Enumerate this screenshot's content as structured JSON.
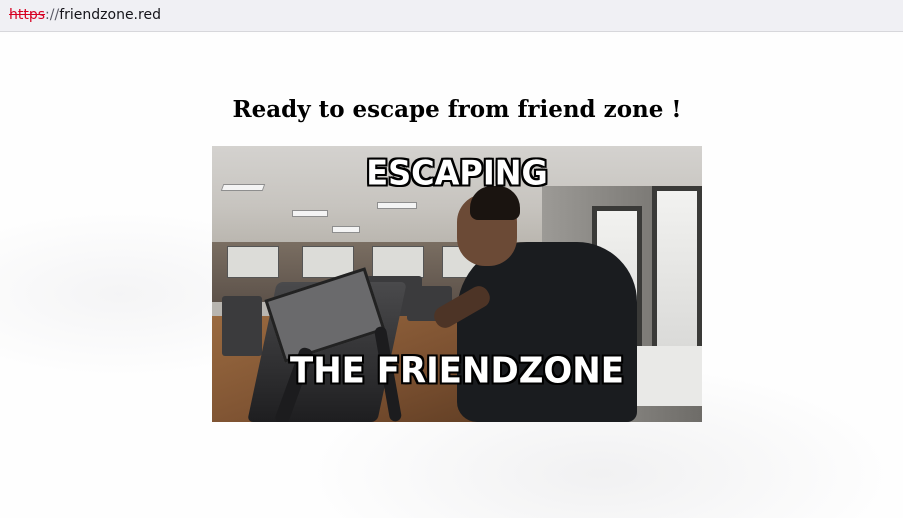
{
  "browser": {
    "url_scheme": "https",
    "url_separator": "://",
    "url_host": "friendzone.red"
  },
  "page": {
    "heading": "Ready to escape from friend zone !",
    "meme": {
      "top_text": "ESCAPING",
      "bottom_text": "THE FRIENDZONE"
    }
  }
}
